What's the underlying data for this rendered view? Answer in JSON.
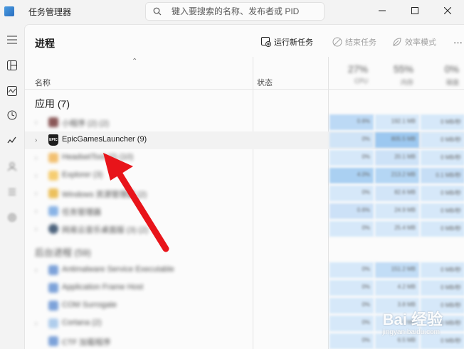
{
  "app": {
    "title": "任务管理器",
    "icon": "task-manager-icon"
  },
  "search": {
    "placeholder": "键入要搜索的名称、发布者或 PID"
  },
  "sidebar": {
    "items": [
      "hamburger-icon",
      "processes-icon",
      "performance-icon",
      "app-history-icon",
      "startup-icon",
      "users-icon",
      "details-icon",
      "services-icon"
    ]
  },
  "page": {
    "title": "进程"
  },
  "toolbar": {
    "run_new_task": "运行新任务",
    "end_task": "结束任务",
    "efficiency_mode": "效率模式",
    "more": "···"
  },
  "columns": {
    "name": "名称",
    "status": "状态"
  },
  "sections": {
    "apps": "应用 (7)",
    "background": "后台进程 (59)"
  },
  "apps": [
    {
      "name": "小程序 (2) (2)",
      "icon_color": "#6b2a2a"
    },
    {
      "name": "EpicGamesLauncher (9)",
      "icon_color": "#1e1e1e"
    },
    {
      "name": "HeadsetTool (2) (10)",
      "icon_color": "#f0b04a"
    },
    {
      "name": "Explorer (3)",
      "icon_color": "#f4c04a"
    },
    {
      "name": "Windows 资源管理器 (2)",
      "icon_color": "#e8b030"
    },
    {
      "name": "任务管理器",
      "icon_color": "#6aa0e0"
    },
    {
      "name": "网易云音乐桌面版 (3) (2)",
      "icon_color": "#1e3a5a"
    }
  ],
  "background": [
    {
      "name": "Antimalware Service Executable",
      "icon_color": "#5a8ad0"
    },
    {
      "name": "Application Frame Host",
      "icon_color": "#5a8ad0"
    },
    {
      "name": "COM Surrogate",
      "icon_color": "#5a8ad0"
    },
    {
      "name": "Cortana (2)",
      "icon_color": "#9ac0e8"
    },
    {
      "name": "CTF 加载程序",
      "icon_color": "#5a8ad0"
    }
  ],
  "metrics": {
    "headers": [
      {
        "pct": "27%",
        "sub": "CPU"
      },
      {
        "pct": "55%",
        "sub": "内存"
      },
      {
        "pct": "0%",
        "sub": "磁盘"
      }
    ],
    "rows": [
      [
        "0.6%",
        "192.1 MB",
        "0 MB/秒"
      ],
      [
        "0%",
        "805.5 MB",
        "0 MB/秒"
      ],
      [
        "0%",
        "20.1 MB",
        "0 MB/秒"
      ],
      [
        "4.0%",
        "213.2 MB",
        "0.1 MB/秒"
      ],
      [
        "0%",
        "82.6 MB",
        "0 MB/秒"
      ],
      [
        "0.6%",
        "24.9 MB",
        "0 MB/秒"
      ],
      [
        "0%",
        "25.4 MB",
        "0 MB/秒"
      ],
      [
        "0%",
        "151.2 MB",
        "0 MB/秒"
      ],
      [
        "0%",
        "4.2 MB",
        "0 MB/秒"
      ],
      [
        "0%",
        "3.8 MB",
        "0 MB/秒"
      ],
      [
        "0%",
        "0 MB",
        "0 MB/秒"
      ],
      [
        "0%",
        "6.5 MB",
        "0 MB/秒"
      ]
    ]
  },
  "watermark": {
    "brand": "Bai 经验",
    "url": "jingyan.baidu.com"
  }
}
